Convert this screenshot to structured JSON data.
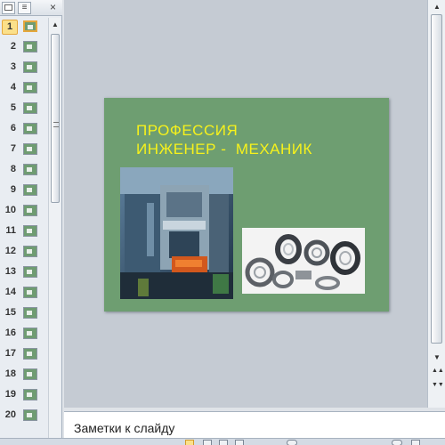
{
  "panel_tabs": {
    "slides_tab": "",
    "outline_tab": "≡",
    "close": "×"
  },
  "thumbnails": [
    {
      "num": "1",
      "selected": true
    },
    {
      "num": "2"
    },
    {
      "num": "3"
    },
    {
      "num": "4"
    },
    {
      "num": "5"
    },
    {
      "num": "6"
    },
    {
      "num": "7"
    },
    {
      "num": "8"
    },
    {
      "num": "9"
    },
    {
      "num": "10"
    },
    {
      "num": "11"
    },
    {
      "num": "12"
    },
    {
      "num": "13"
    },
    {
      "num": "14"
    },
    {
      "num": "15"
    },
    {
      "num": "16"
    },
    {
      "num": "17"
    },
    {
      "num": "18"
    },
    {
      "num": "19"
    },
    {
      "num": "20"
    }
  ],
  "slide": {
    "title_line_1": "ПРОФЕССИЯ",
    "title_line_2": "ИНЖЕНЕР -  МЕХАНИК",
    "background_color": "#6e9e71",
    "title_color": "#f7f21b",
    "images": [
      "industrial-press-machine-photo",
      "bearings-photo"
    ]
  },
  "notes": {
    "placeholder": "Заметки к слайду"
  },
  "scroll": {
    "up": "▲",
    "down": "▼",
    "prev_slide": "▲▲",
    "next_slide": "▼▼"
  }
}
